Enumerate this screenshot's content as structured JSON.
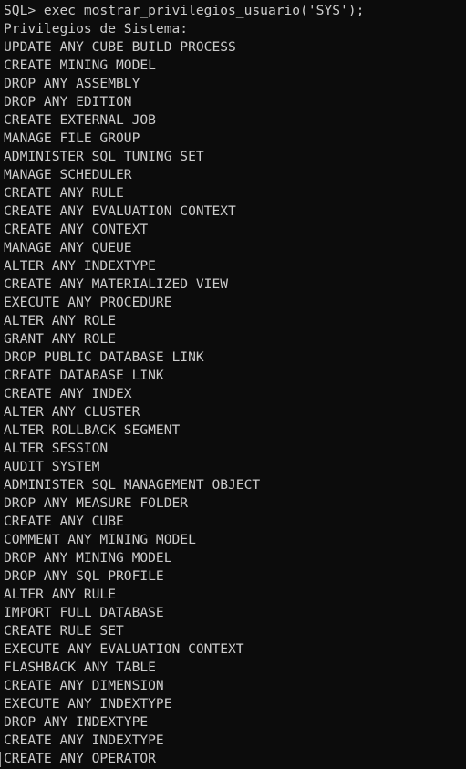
{
  "terminal": {
    "command": "SQL> exec mostrar_privilegios_usuario('SYS');",
    "header": "Privilegios de Sistema:",
    "privileges": [
      "UPDATE ANY CUBE BUILD PROCESS",
      "CREATE MINING MODEL",
      "DROP ANY ASSEMBLY",
      "DROP ANY EDITION",
      "CREATE EXTERNAL JOB",
      "MANAGE FILE GROUP",
      "ADMINISTER SQL TUNING SET",
      "MANAGE SCHEDULER",
      "CREATE ANY RULE",
      "CREATE ANY EVALUATION CONTEXT",
      "CREATE ANY CONTEXT",
      "MANAGE ANY QUEUE",
      "ALTER ANY INDEXTYPE",
      "CREATE ANY MATERIALIZED VIEW",
      "EXECUTE ANY PROCEDURE",
      "ALTER ANY ROLE",
      "GRANT ANY ROLE",
      "DROP PUBLIC DATABASE LINK",
      "CREATE DATABASE LINK",
      "CREATE ANY INDEX",
      "ALTER ANY CLUSTER",
      "ALTER ROLLBACK SEGMENT",
      "ALTER SESSION",
      "AUDIT SYSTEM",
      "ADMINISTER SQL MANAGEMENT OBJECT",
      "DROP ANY MEASURE FOLDER",
      "CREATE ANY CUBE",
      "COMMENT ANY MINING MODEL",
      "DROP ANY MINING MODEL",
      "DROP ANY SQL PROFILE",
      "ALTER ANY RULE",
      "IMPORT FULL DATABASE",
      "CREATE RULE SET",
      "EXECUTE ANY EVALUATION CONTEXT",
      "FLASHBACK ANY TABLE",
      "CREATE ANY DIMENSION",
      "EXECUTE ANY INDEXTYPE",
      "DROP ANY INDEXTYPE",
      "CREATE ANY INDEXTYPE",
      "CREATE ANY OPERATOR"
    ]
  }
}
